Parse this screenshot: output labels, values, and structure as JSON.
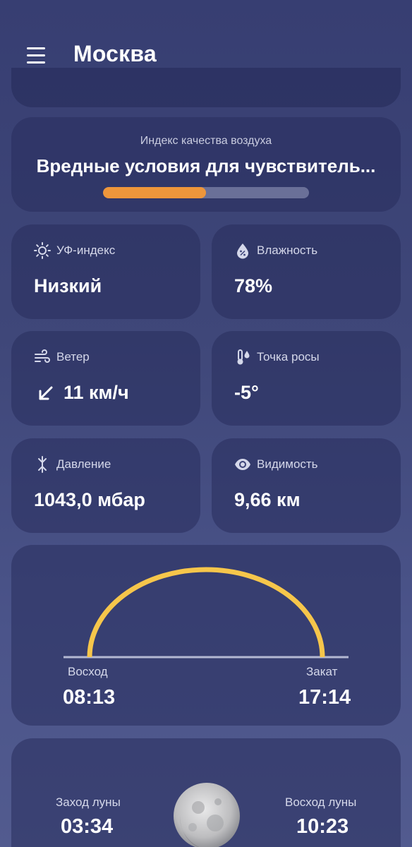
{
  "header": {
    "city": "Москва",
    "menu_icon": "hamburger-menu-icon"
  },
  "air_quality": {
    "label": "Индекс качества воздуха",
    "value": "Вредные условия для чувствитель...",
    "level_fraction": 0.5,
    "bar_color": "#ee963b"
  },
  "tiles": {
    "uv": {
      "label": "УФ-индекс",
      "value": "Низкий",
      "icon": "sun-icon"
    },
    "humidity": {
      "label": "Влажность",
      "value": "78%",
      "icon": "humidity-drop-icon"
    },
    "wind": {
      "label": "Ветер",
      "value": "11 км/ч",
      "icon": "wind-icon",
      "direction_icon": "arrow-down-left-icon"
    },
    "dew_point": {
      "label": "Точка росы",
      "value": "-5°",
      "icon": "thermometer-drop-icon"
    },
    "pressure": {
      "label": "Давление",
      "value": "1043,0 мбар",
      "icon": "pressure-icon"
    },
    "visibility": {
      "label": "Видимость",
      "value": "9,66 км",
      "icon": "eye-icon"
    }
  },
  "sun": {
    "sunrise_label": "Восход",
    "sunrise_time": "08:13",
    "sunset_label": "Закат",
    "sunset_time": "17:14",
    "arc_color": "#f6c64b"
  },
  "moon": {
    "moonset_label": "Заход луны",
    "moonset_time": "03:34",
    "moonrise_label": "Восход луны",
    "moonrise_time": "10:23",
    "icon": "moon-icon"
  }
}
